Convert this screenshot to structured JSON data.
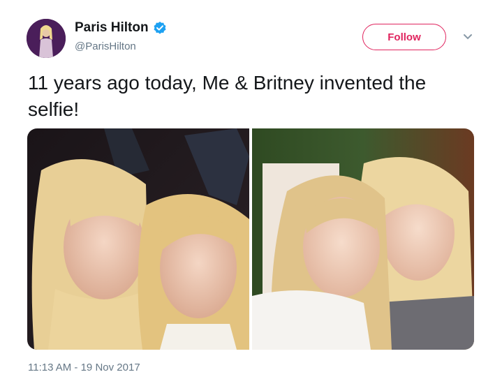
{
  "user": {
    "display_name": "Paris Hilton",
    "handle": "@ParisHilton",
    "verified_icon": "verified-badge-icon"
  },
  "follow_button": {
    "label": "Follow"
  },
  "menu": {
    "icon": "chevron-down-icon"
  },
  "tweet": {
    "text": "11 years ago today, Me & Britney invented the selfie!",
    "timestamp": "11:13 AM - 19 Nov 2017"
  },
  "media": [
    {
      "type": "photo"
    },
    {
      "type": "photo"
    }
  ],
  "colors": {
    "follow_accent": "#e0245e",
    "verified_blue": "#1da1f2",
    "secondary_text": "#657786",
    "primary_text": "#14171a"
  }
}
